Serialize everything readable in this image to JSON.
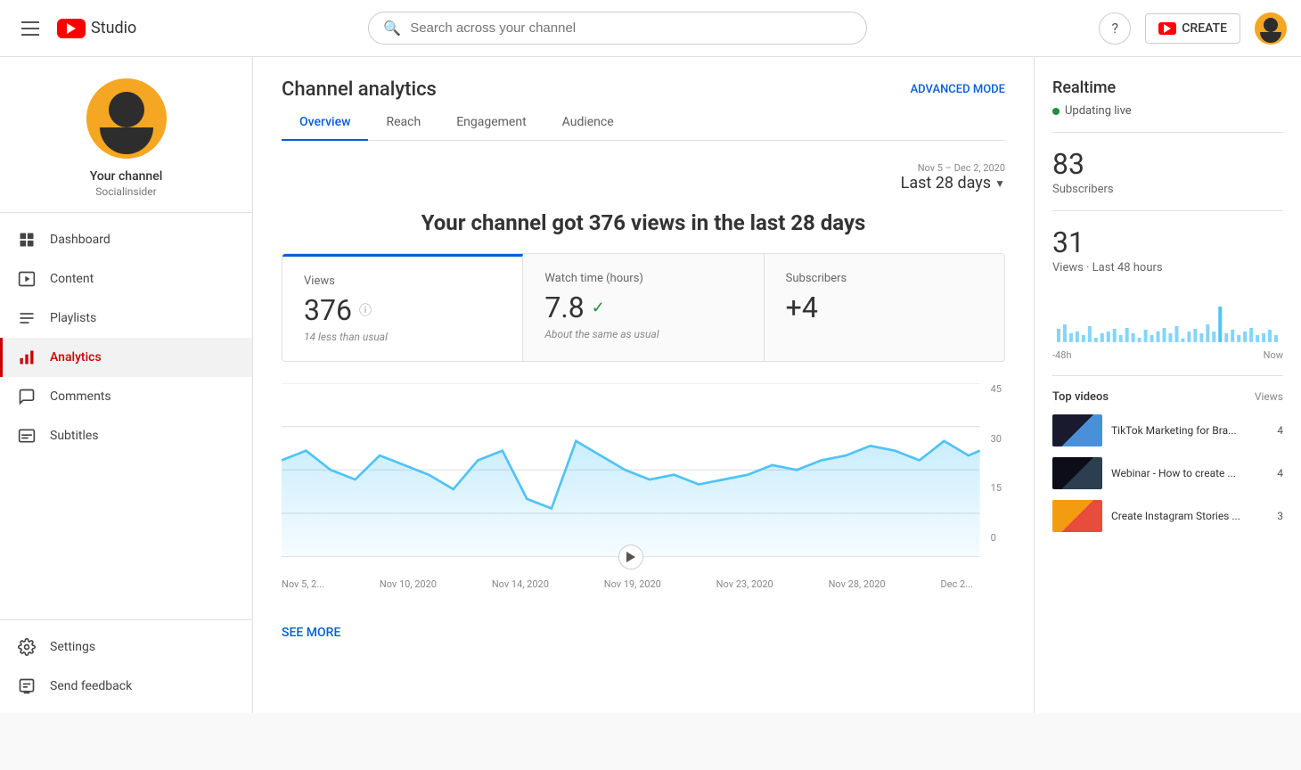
{
  "topnav": {
    "logo_text": "Studio",
    "search_placeholder": "Search across your channel",
    "create_label": "CREATE",
    "help_icon": "?",
    "avatar_alt": "user avatar"
  },
  "sidebar": {
    "channel_name": "Your channel",
    "channel_handle": "Socialinsider",
    "nav_items": [
      {
        "id": "dashboard",
        "label": "Dashboard",
        "icon": "grid"
      },
      {
        "id": "content",
        "label": "Content",
        "icon": "play"
      },
      {
        "id": "playlists",
        "label": "Playlists",
        "icon": "list"
      },
      {
        "id": "analytics",
        "label": "Analytics",
        "icon": "bar-chart",
        "active": true
      },
      {
        "id": "comments",
        "label": "Comments",
        "icon": "comment"
      },
      {
        "id": "subtitles",
        "label": "Subtitles",
        "icon": "subtitle"
      }
    ],
    "bottom_items": [
      {
        "id": "settings",
        "label": "Settings",
        "icon": "gear"
      },
      {
        "id": "feedback",
        "label": "Send feedback",
        "icon": "feedback"
      }
    ]
  },
  "main": {
    "page_title": "Channel analytics",
    "advanced_mode": "ADVANCED MODE",
    "tabs": [
      {
        "id": "overview",
        "label": "Overview",
        "active": true
      },
      {
        "id": "reach",
        "label": "Reach"
      },
      {
        "id": "engagement",
        "label": "Engagement"
      },
      {
        "id": "audience",
        "label": "Audience"
      }
    ],
    "date_range": {
      "sub_label": "Nov 5 – Dec 2, 2020",
      "value": "Last 28 days"
    },
    "summary_heading": "Your channel got 376 views in the last 28 days",
    "metrics": [
      {
        "id": "views",
        "label": "Views",
        "value": "376",
        "note": "14 less than usual",
        "active": true
      },
      {
        "id": "watch_time",
        "label": "Watch time (hours)",
        "value": "7.8",
        "note": "About the same as usual",
        "has_check": true
      },
      {
        "id": "subscribers",
        "label": "Subscribers",
        "value": "+4",
        "note": ""
      }
    ],
    "chart_labels": [
      "Nov 5, 2...",
      "Nov 10, 2020",
      "Nov 14, 2020",
      "Nov 19, 2020",
      "Nov 23, 2020",
      "Nov 28, 2020",
      "Dec 2..."
    ],
    "chart_y_labels": [
      "45",
      "30",
      "15",
      "0"
    ],
    "see_more": "SEE MORE"
  },
  "right_panel": {
    "realtime_title": "Realtime",
    "realtime_live": "Updating live",
    "subscribers_count": "83",
    "subscribers_label": "Subscribers",
    "views_count": "31",
    "views_label": "Views · Last 48 hours",
    "mini_chart_labels": [
      "-48h",
      "Now"
    ],
    "top_videos_title": "Top videos",
    "top_videos_col": "Views",
    "videos": [
      {
        "title": "TikTok Marketing for Bra...",
        "views": "4",
        "thumb_class": "video-thumb-1"
      },
      {
        "title": "Webinar - How to create ...",
        "views": "4",
        "thumb_class": "video-thumb-2"
      },
      {
        "title": "Create Instagram Stories ...",
        "views": "3",
        "thumb_class": "video-thumb-3"
      }
    ]
  }
}
